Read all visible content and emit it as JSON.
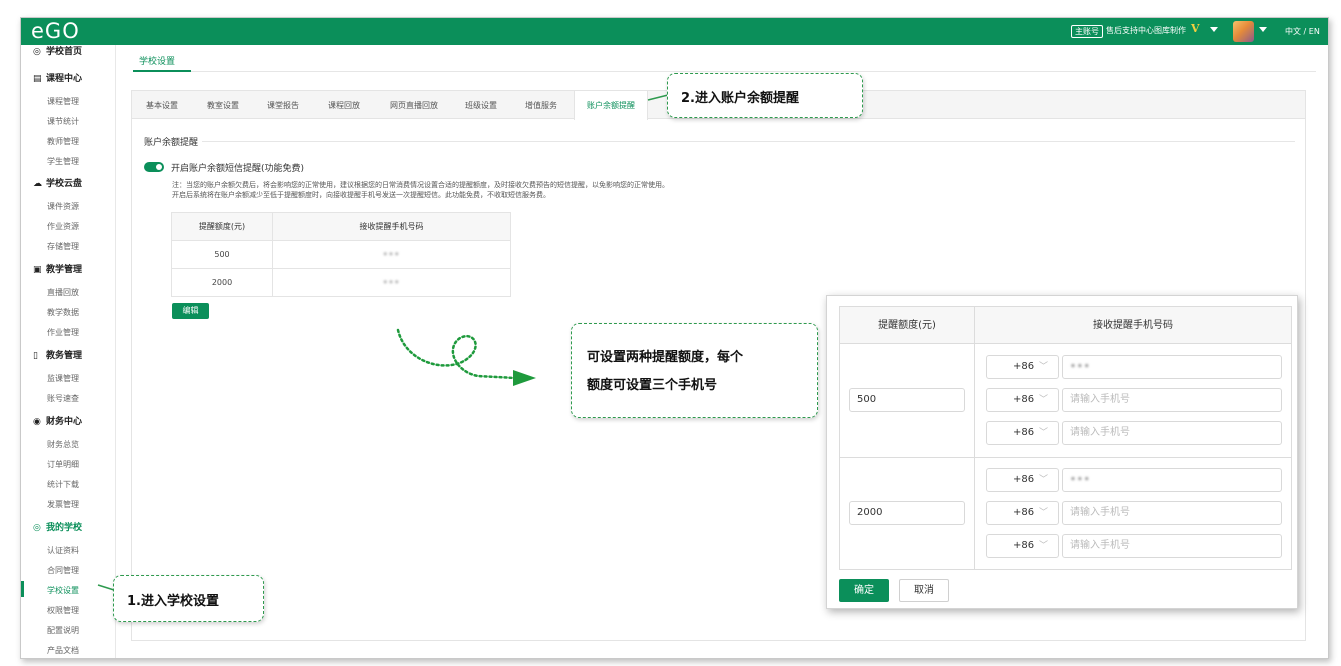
{
  "header": {
    "logo": "eGO",
    "account_badge": "主账号",
    "account_name": "售后支持中心图库制作",
    "vip_badge": "V",
    "language": "中文 / EN"
  },
  "sidebar": {
    "sections": [
      {
        "label": "学校首页",
        "icon": "◎",
        "items": []
      },
      {
        "label": "课程中心",
        "icon": "▤",
        "items": [
          "课程管理",
          "课节统计",
          "教师管理",
          "学生管理"
        ]
      },
      {
        "label": "学校云盘",
        "icon": "☁",
        "items": [
          "课件资源",
          "作业资源",
          "存储管理"
        ]
      },
      {
        "label": "教学管理",
        "icon": "▣",
        "items": [
          "直播回放",
          "教学数据",
          "作业管理"
        ]
      },
      {
        "label": "教务管理",
        "icon": "▯",
        "items": [
          "监课管理",
          "账号速查"
        ]
      },
      {
        "label": "财务中心",
        "icon": "◉",
        "items": [
          "财务总览",
          "订单明细",
          "统计下载",
          "发票管理"
        ]
      },
      {
        "label": "我的学校",
        "icon": "◎",
        "items": [
          "认证资料",
          "合同管理",
          "学校设置",
          "权限管理",
          "配置说明",
          "产品文档"
        ]
      }
    ],
    "active_item": "学校设置"
  },
  "page": {
    "tab": "学校设置",
    "subtabs": [
      "基本设置",
      "教室设置",
      "课堂报告",
      "课程回放",
      "网页直播回放",
      "班级设置",
      "增值服务",
      "账户余额提醒"
    ],
    "active_subtab": "账户余额提醒",
    "section_title": "账户余额提醒",
    "toggle_label": "开启账户余额短信提醒(功能免费)",
    "note_line1": "注：当您的账户余额欠费后，将会影响您的正常使用，建议根据您的日常消费情况设置合适的提醒额度，及时接收欠费预告的短信提醒，以免影响您的正常使用。",
    "note_line2": "开启后系统将在账户余额减少至低于提醒额度时，向接收提醒手机号发送一次提醒短信。此功能免费，不收取短信服务费。",
    "table": {
      "headers": [
        "提醒额度(元)",
        "接收提醒手机号码"
      ],
      "rows": [
        {
          "amount": "500",
          "phone": "•••"
        },
        {
          "amount": "2000",
          "phone": "•••"
        }
      ]
    },
    "edit_button": "编辑"
  },
  "callouts": {
    "step1": "1.进入学校设置",
    "step2": "2.进入账户余额提醒",
    "info_line1": "可设置两种提醒额度，每个",
    "info_line2": "额度可设置三个手机号"
  },
  "edit_dialog": {
    "headers": [
      "提醒额度(元)",
      "接收提醒手机号码"
    ],
    "groups": [
      {
        "amount": "500",
        "phones": [
          {
            "code": "+86",
            "value": "•••",
            "placeholder": ""
          },
          {
            "code": "+86",
            "value": "",
            "placeholder": "请输入手机号"
          },
          {
            "code": "+86",
            "value": "",
            "placeholder": "请输入手机号"
          }
        ]
      },
      {
        "amount": "2000",
        "phones": [
          {
            "code": "+86",
            "value": "•••",
            "placeholder": ""
          },
          {
            "code": "+86",
            "value": "",
            "placeholder": "请输入手机号"
          },
          {
            "code": "+86",
            "value": "",
            "placeholder": "请输入手机号"
          }
        ]
      }
    ],
    "confirm_button": "确定",
    "cancel_button": "取消"
  },
  "colors": {
    "brand_green": "#0b8f5a",
    "callout_border": "#2e9a4e",
    "arrow_green": "#1e9a3c"
  }
}
